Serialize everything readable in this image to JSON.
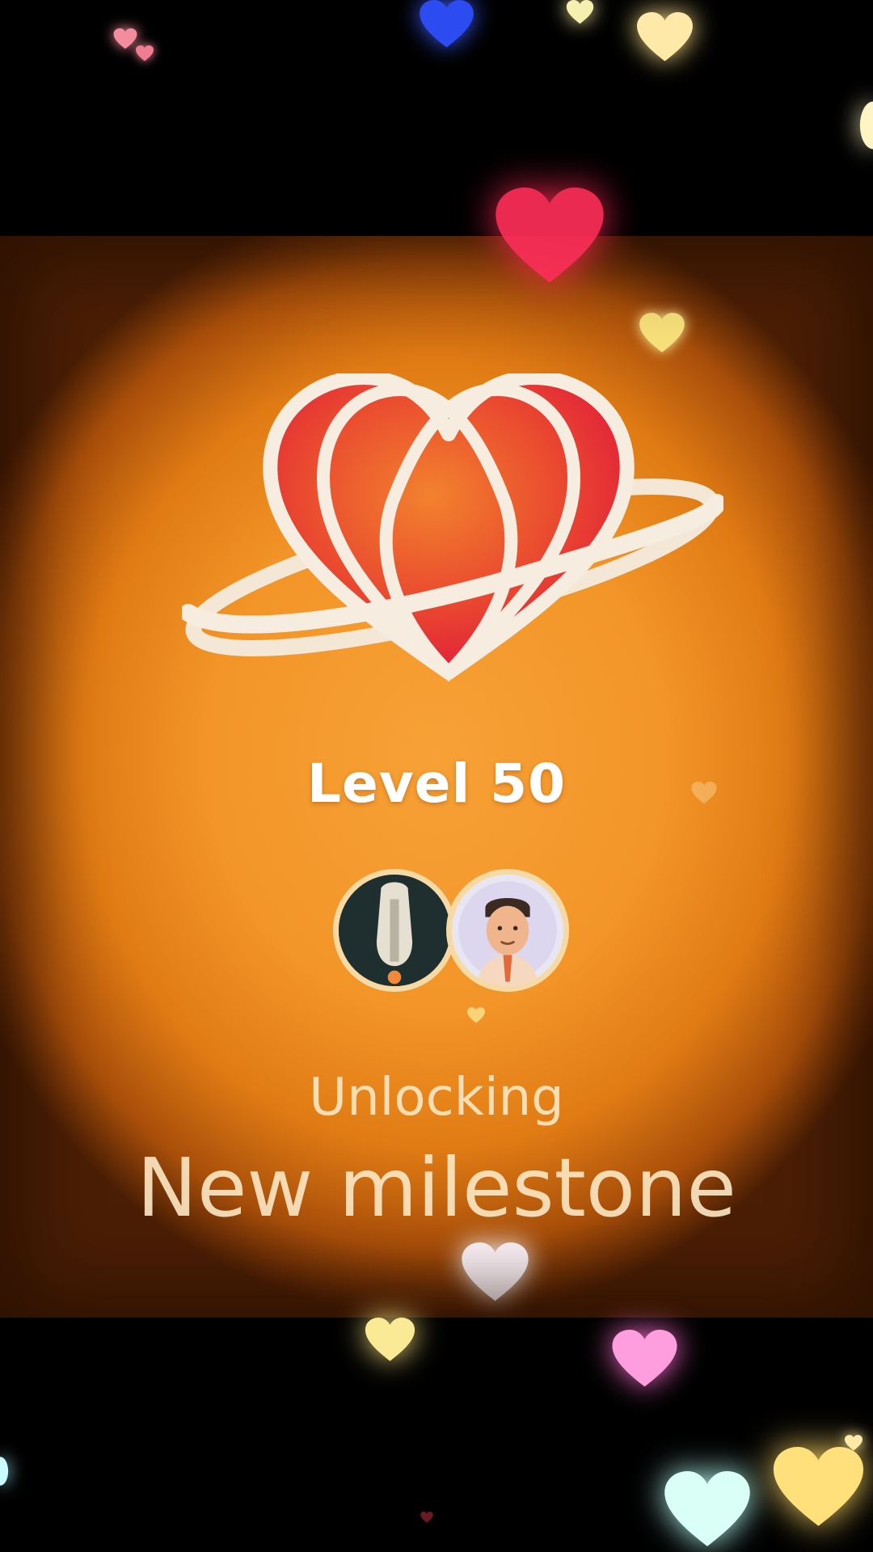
{
  "milestone_card": {
    "level_label": "Level 50",
    "unlocking_label": "Unlocking",
    "milestone_label": "New milestone"
  },
  "colors": {
    "panel_orange": "#f39528",
    "text_light": "#fbe6c2",
    "heart_red": "#e8203c",
    "ring_white": "#f6ece0"
  },
  "icons": {
    "logo": "heart-planet-icon",
    "decorations": "floating-heart-icon"
  }
}
